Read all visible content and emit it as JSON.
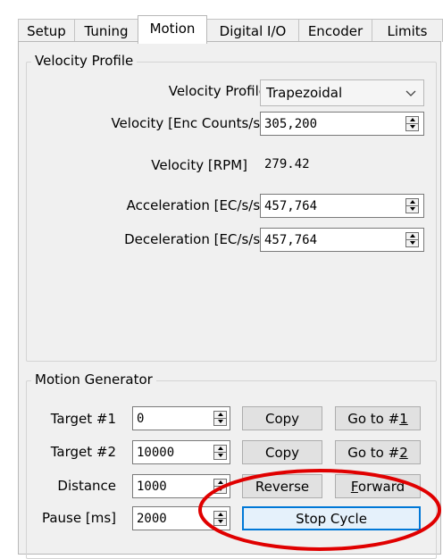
{
  "tabs": [
    {
      "label": "Setup"
    },
    {
      "label": "Tuning"
    },
    {
      "label": "Motion"
    },
    {
      "label": "Digital I/O"
    },
    {
      "label": "Encoder"
    },
    {
      "label": "Limits"
    }
  ],
  "active_tab": "Motion",
  "velocity_profile": {
    "group_title": "Velocity Profile",
    "profile_label": "Velocity Profile",
    "profile_value": "Trapezoidal",
    "velocity_label": "Velocity [Enc Counts/s]",
    "velocity_value": "305,200",
    "rpm_label": "Velocity [RPM]",
    "rpm_value": "279.42",
    "acceleration_label": "Acceleration [EC/s/s]",
    "acceleration_value": "457,764",
    "deceleration_label": "Deceleration [EC/s/s]",
    "deceleration_value": "457,764"
  },
  "motion_generator": {
    "group_title": "Motion Generator",
    "target1_label": "Target #1",
    "target1_value": "0",
    "target2_label": "Target #2",
    "target2_value": "10000",
    "distance_label": "Distance",
    "distance_value": "1000",
    "pause_label": "Pause [ms]",
    "pause_value": "2000",
    "copy_label": "Copy",
    "goto1_prefix": "Go to #",
    "goto1_mnemonic": "1",
    "goto2_prefix": "Go to #",
    "goto2_mnemonic": "2",
    "reverse_label": "Reverse",
    "forward_mnemonic": "F",
    "forward_rest": "orward",
    "stop_cycle_label": "Stop Cycle"
  },
  "colors": {
    "highlight_ellipse": "#e00000",
    "focus_border": "#0078d7"
  }
}
